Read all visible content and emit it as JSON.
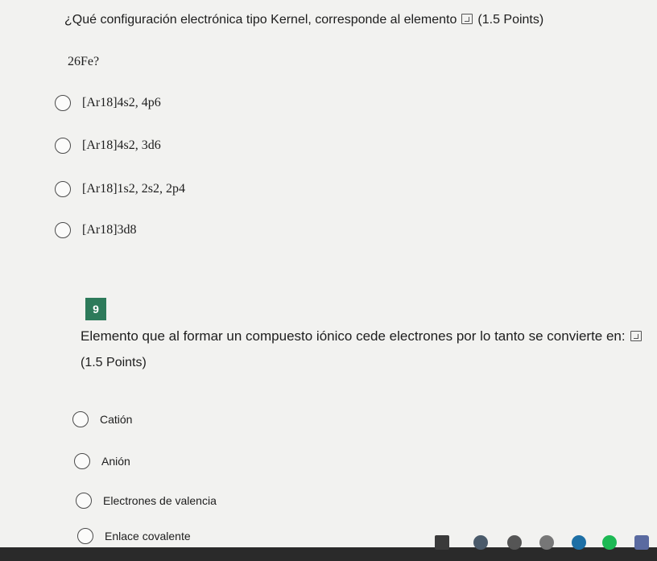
{
  "q8": {
    "prompt_start": "¿Qué configuración electrónica tipo Kernel, corresponde al elemento",
    "points": "(1.5 Points)",
    "element": "26Fe?",
    "options": [
      {
        "label": "[Ar18]4s2, 4p6"
      },
      {
        "label": "[Ar18]4s2, 3d6"
      },
      {
        "label": "[Ar18]1s2, 2s2, 2p4"
      },
      {
        "label": "[Ar18]3d8"
      }
    ]
  },
  "q9": {
    "number": "9",
    "prompt": "Elemento que al formar un compuesto iónico cede electrones por lo tanto se convierte en:",
    "points": "(1.5 Points)",
    "options": [
      {
        "label": "Catión"
      },
      {
        "label": "Anión"
      },
      {
        "label": "Electrones de valencia"
      },
      {
        "label": "Enlace covalente"
      }
    ]
  }
}
